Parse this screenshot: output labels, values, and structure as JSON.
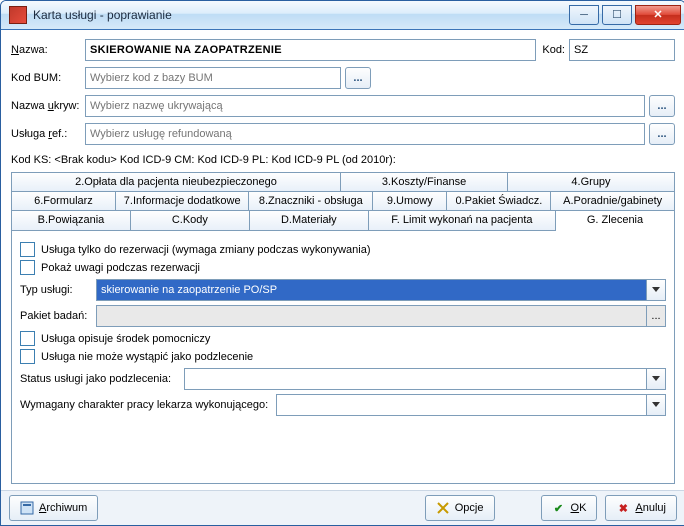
{
  "window": {
    "title": "Karta usługi - poprawianie"
  },
  "form": {
    "nazwa_label": "Nazwa:",
    "nazwa_hot": "N",
    "nazwa_value": "SKIEROWANIE NA ZAOPATRZENIE",
    "kod_label": "Kod:",
    "kod_value": "SZ",
    "kodbum_label": "Kod BUM:",
    "kodbum_placeholder": "Wybierz kod z bazy BUM",
    "nazwaukr_label": "Nazwa ukryw:",
    "nazwaukr_hot": "u",
    "nazwaukr_placeholder": "Wybierz nazwę ukrywającą",
    "uslugaref_label": "Usługa ref.:",
    "uslugaref_hot": "r",
    "uslugaref_placeholder": "Wybierz usługę refundowaną",
    "static_line": "Kod KS: <Brak kodu>   Kod ICD-9 CM:   Kod ICD-9 PL:   Kod ICD-9 PL (od 2010r):"
  },
  "tabs": {
    "row1": [
      "2.Opłata dla pacjenta nieubezpieczonego",
      "3.Koszty/Finanse",
      "4.Grupy"
    ],
    "row2": [
      "6.Formularz",
      "7.Informacje dodatkowe",
      "8.Znaczniki - obsługa",
      "9.Umowy",
      "0.Pakiet Świadcz.",
      "A.Poradnie/gabinety"
    ],
    "row3": [
      "B.Powiązania",
      "C.Kody",
      "D.Materiały",
      "F. Limit wykonań na pacjenta",
      "G. Zlecenia"
    ],
    "active": "G. Zlecenia"
  },
  "g": {
    "chk1": "Usługa tylko do rezerwacji (wymaga zmiany podczas wykonywania)",
    "chk2": "Pokaż uwagi podczas rezerwacji",
    "typ_label": "Typ usługi:",
    "typ_value": "skierowanie na zaopatrzenie PO/SP",
    "pakiet_label": "Pakiet badań:",
    "pakiet_value": "",
    "chk3": "Usługa opisuje środek pomocniczy",
    "chk4": "Usługa nie może wystąpić jako podzlecenie",
    "status_label": "Status usługi jako podzlecenia:",
    "status_value": "",
    "wymag_label": "Wymagany charakter pracy lekarza wykonującego:",
    "wymag_value": ""
  },
  "buttons": {
    "archiwum": "Archiwum",
    "opcje": "Opcje",
    "ok": "OK",
    "anuluj": "Anuluj"
  }
}
